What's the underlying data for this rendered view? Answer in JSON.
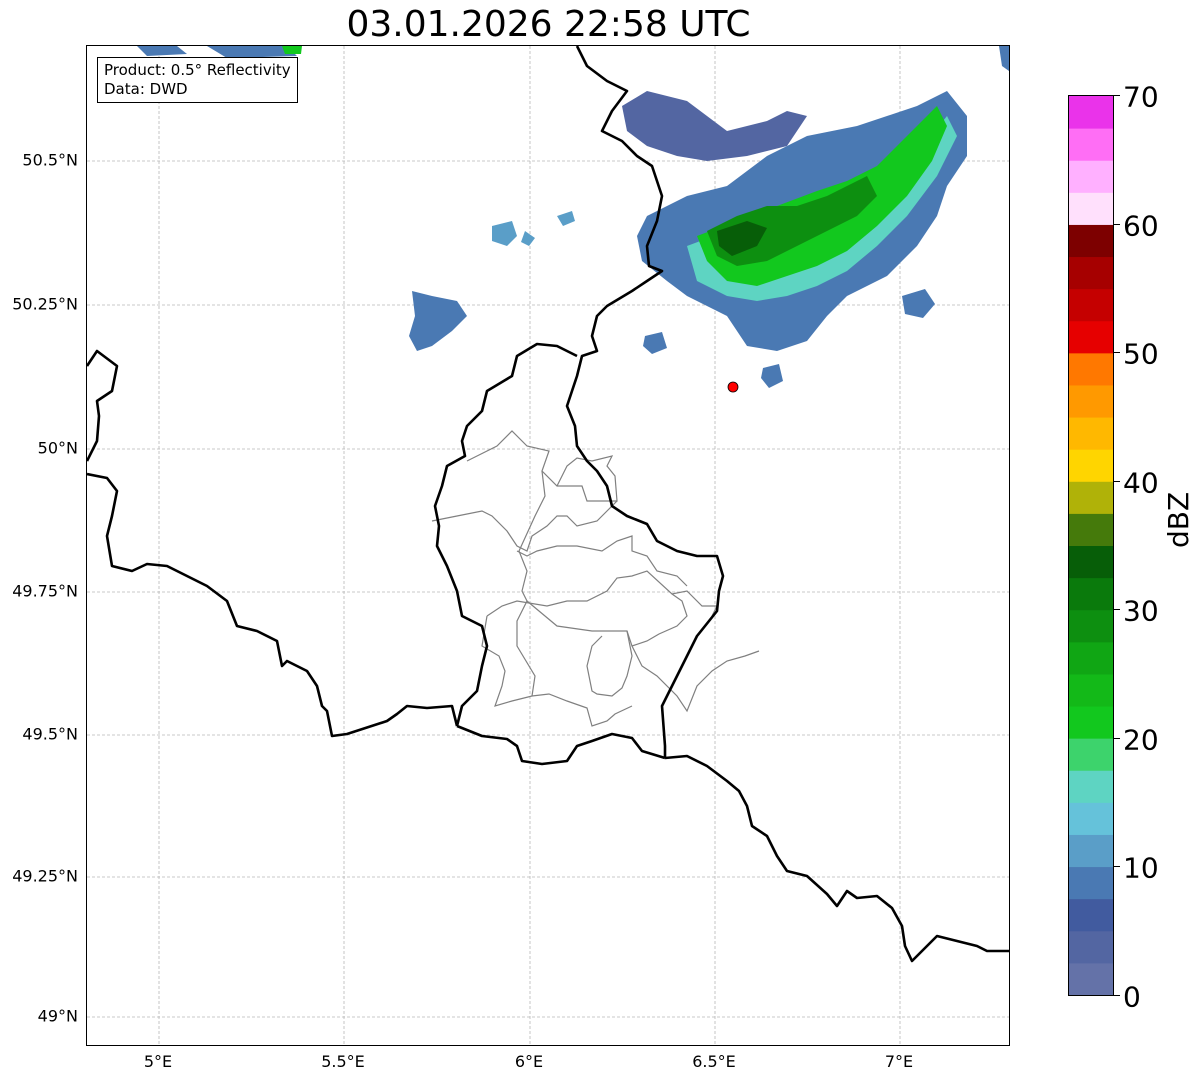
{
  "title": "03.01.2026 22:58 UTC",
  "info_box": {
    "product": "Product: 0.5° Reflectivity",
    "source": "Data: DWD"
  },
  "axes": {
    "lat_ticks": [
      "50.5°N",
      "50.25°N",
      "50°N",
      "49.75°N",
      "49.5°N",
      "49.25°N",
      "49°N"
    ],
    "lon_ticks": [
      "5°E",
      "5.5°E",
      "6°E",
      "6.5°E",
      "7°E"
    ],
    "lat_range": [
      48.95,
      50.7
    ],
    "lon_range": [
      4.8,
      7.3
    ],
    "grid": true
  },
  "colorbar": {
    "unit": "dBZ",
    "min": 0,
    "max": 70,
    "ticks": [
      "0",
      "10",
      "20",
      "30",
      "40",
      "50",
      "60",
      "70"
    ],
    "colors": [
      "#6472a8",
      "#5366a2",
      "#415b9f",
      "#4a79b3",
      "#5a9ec8",
      "#65c2da",
      "#5ed4c2",
      "#3dd36c",
      "#12c81e",
      "#13b918",
      "#10a614",
      "#0d8f10",
      "#0a7a0c",
      "#075e08",
      "#457a0b",
      "#b0b208",
      "#ffd500",
      "#ffb800",
      "#ff9900",
      "#ff7800",
      "#e60000",
      "#c50000",
      "#a60000",
      "#7d0000",
      "#ffe0fc",
      "#ffb0ff",
      "#ff6ef5",
      "#ea33ea"
    ]
  },
  "radar_site": {
    "lon": 6.548,
    "lat": 50.11,
    "color": "#ff0000"
  },
  "colors": {
    "border": "#000000",
    "admin_border": "#808080",
    "gridline": "#b8b8b8"
  }
}
